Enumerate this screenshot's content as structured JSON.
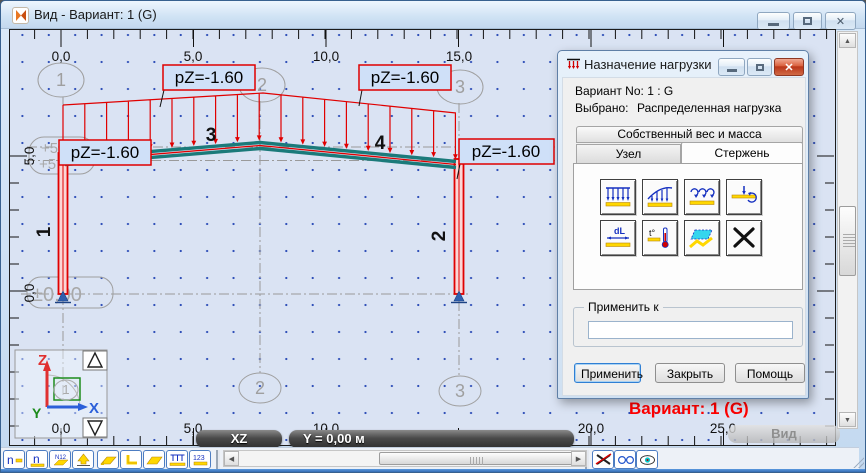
{
  "window": {
    "title": "Вид - Вариант: 1 (G)"
  },
  "drawing": {
    "load_labels": [
      "pZ=-1.60",
      "pZ=-1.60",
      "pZ=-1.60",
      "pZ=-1.60"
    ],
    "axis_bubbles": {
      "top1": "1",
      "top2": "2",
      "top3": "3",
      "bottom2": "2",
      "bottom3": "3"
    },
    "elements": {
      "left_column": "1",
      "right_column": "2",
      "left_beam": "3",
      "right_beam": "4"
    },
    "elevations": {
      "eave_a": "+5",
      "eave_b": "+5",
      "base": "±0,00"
    },
    "rulers": {
      "top": [
        "0,0",
        "5,0",
        "10,0",
        "15,0"
      ],
      "left": [
        "5,0",
        "0,0"
      ],
      "bottom": [
        "0,0",
        "5,0",
        "10,0",
        "20,0",
        "25,0"
      ]
    },
    "axes": {
      "z": "Z",
      "x": "X",
      "y": "Y",
      "bubble": "1"
    },
    "variant_overlay": "Вариант: 1 (G)"
  },
  "statusbar": {
    "plane": "XZ",
    "y_coord": "Y = 0,00 м",
    "watermark": "Вид"
  },
  "toolbar": {
    "glyphs": {
      "n1": "n",
      "n2": "n",
      "n3": "N12",
      "n9": "123"
    }
  },
  "dialog": {
    "title": "Назначение нагрузки",
    "variant": "Вариант No: 1 : G",
    "selected_label": "Выбрано:",
    "selected_value": "Распределенная нагрузка",
    "weight_button": "Собственный вес и масса",
    "tab_node": "Узел",
    "tab_bar": "Стержень",
    "icon_texts": {
      "dl": "dL",
      "temp": "t°"
    },
    "apply_group": "Применить к",
    "input_value": "",
    "btn_apply": "Применить",
    "btn_close": "Закрыть",
    "btn_help": "Помощь"
  },
  "colors": {
    "load": "#e00000",
    "beam": "#1b7a7a",
    "label_bg": "#cfe0f8",
    "variant": "#fe0000"
  }
}
